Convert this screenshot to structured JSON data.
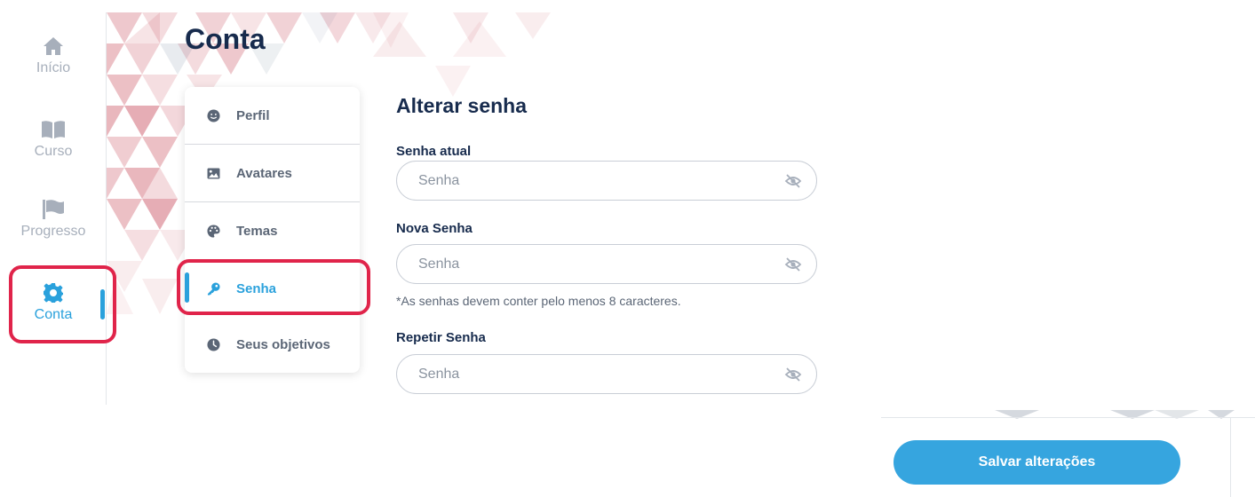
{
  "rail": {
    "items": [
      {
        "label": "Início",
        "icon": "home-icon"
      },
      {
        "label": "Curso",
        "icon": "book-icon"
      },
      {
        "label": "Progresso",
        "icon": "flag-icon"
      },
      {
        "label": "Conta",
        "icon": "gear-icon",
        "active": true
      }
    ]
  },
  "page": {
    "title": "Conta"
  },
  "submenu": {
    "items": [
      {
        "label": "Perfil",
        "icon": "smiley-icon"
      },
      {
        "label": "Avatares",
        "icon": "image-icon"
      },
      {
        "label": "Temas",
        "icon": "palette-icon"
      },
      {
        "label": "Senha",
        "icon": "key-icon",
        "active": true
      },
      {
        "label": "Seus objetivos",
        "icon": "clock-icon"
      }
    ]
  },
  "form": {
    "title": "Alterar senha",
    "current": {
      "label": "Senha atual",
      "placeholder": "Senha"
    },
    "new": {
      "label": "Nova Senha",
      "placeholder": "Senha"
    },
    "hint": "*As senhas devem conter pelo menos 8 caracteres.",
    "repeat": {
      "label": "Repetir Senha",
      "placeholder": "Senha"
    }
  },
  "actions": {
    "save_label": "Salvar alterações"
  },
  "colors": {
    "accent": "#2aa1dc",
    "highlight": "#e0244a",
    "text": "#172b4d",
    "muted": "#a7afbb"
  }
}
